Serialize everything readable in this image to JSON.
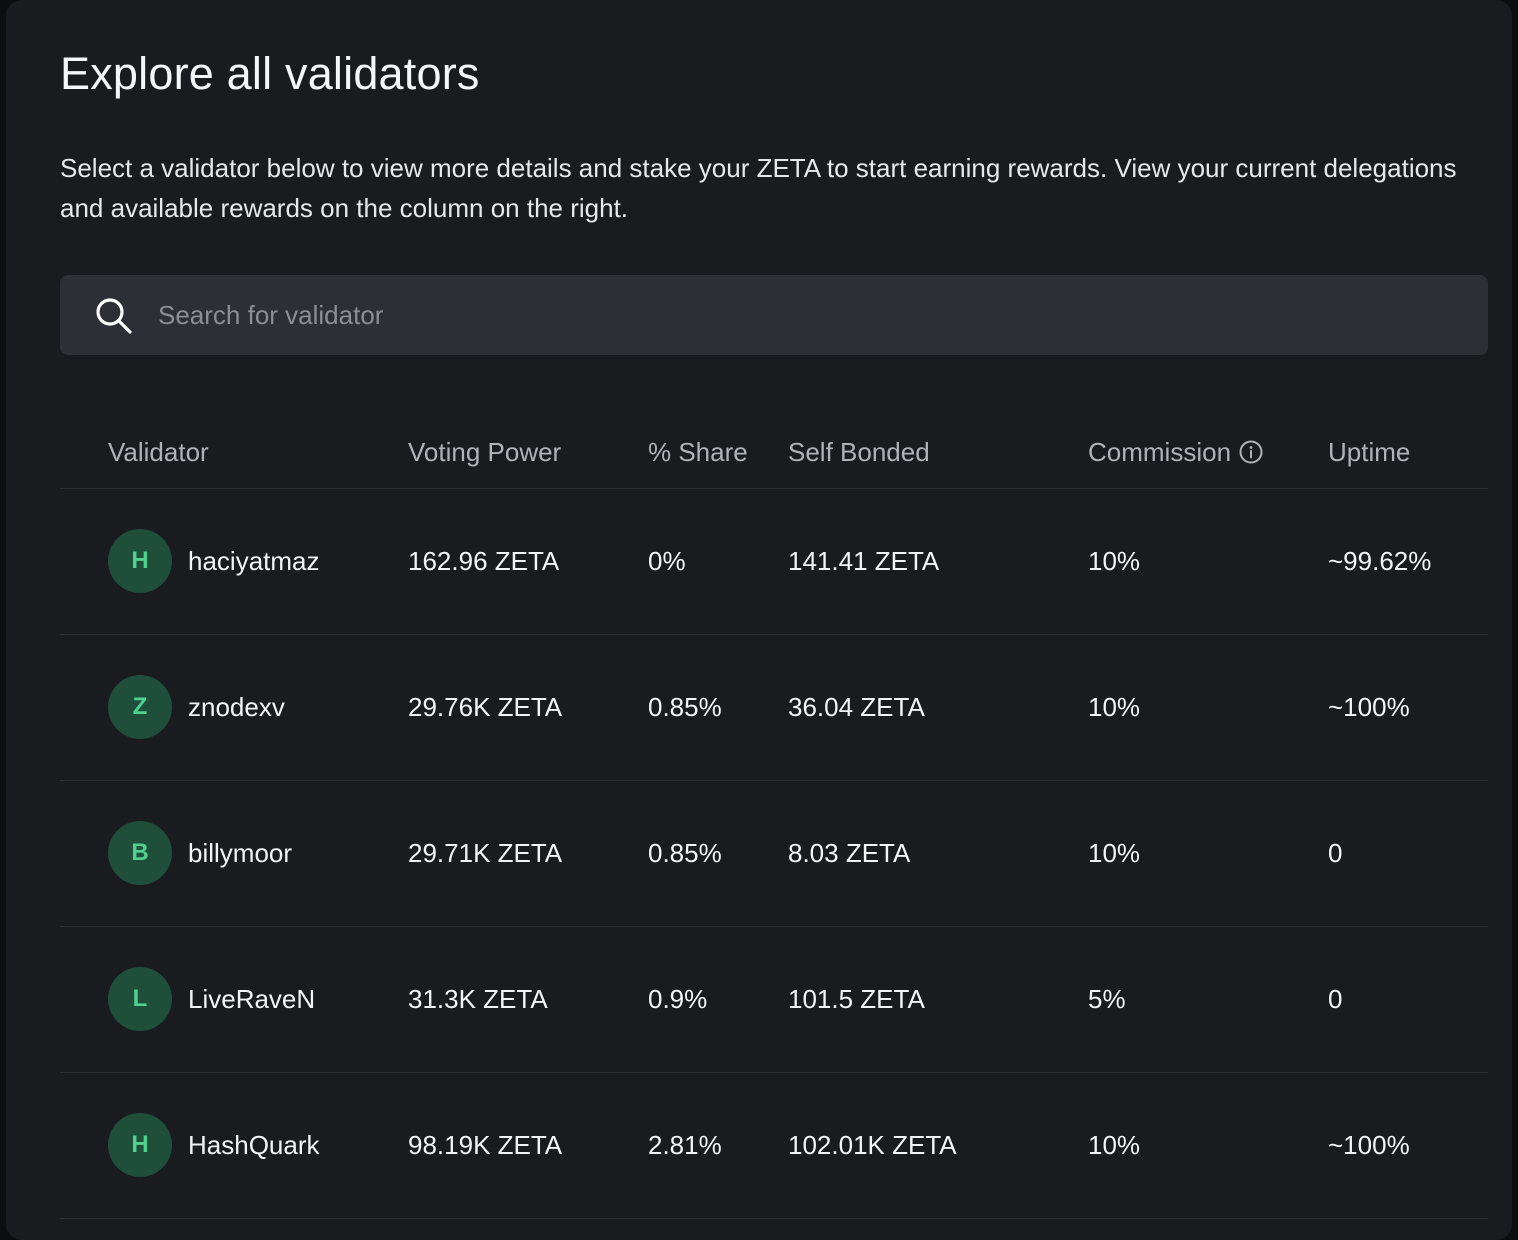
{
  "page": {
    "title": "Explore all validators",
    "description": "Select a validator below to view more details and stake your ZETA to start earning rewards. View your current delegations and available rewards on the column on the right."
  },
  "search": {
    "placeholder": "Search for validator",
    "value": "",
    "icon": "search-icon"
  },
  "table": {
    "headers": {
      "validator": "Validator",
      "voting_power": "Voting Power",
      "share": "% Share",
      "self_bonded": "Self Bonded",
      "commission": "Commission",
      "commission_icon": "info-icon",
      "uptime": "Uptime"
    },
    "rows": [
      {
        "initial": "H",
        "name": "haciyatmaz",
        "voting_power": "162.96 ZETA",
        "share": "0%",
        "self_bonded": "141.41 ZETA",
        "commission": "10%",
        "uptime": "~99.62%"
      },
      {
        "initial": "Z",
        "name": "znodexv",
        "voting_power": "29.76K ZETA",
        "share": "0.85%",
        "self_bonded": "36.04 ZETA",
        "commission": "10%",
        "uptime": "~100%"
      },
      {
        "initial": "B",
        "name": "billymoor",
        "voting_power": "29.71K ZETA",
        "share": "0.85%",
        "self_bonded": "8.03 ZETA",
        "commission": "10%",
        "uptime": "0"
      },
      {
        "initial": "L",
        "name": "LiveRaveN",
        "voting_power": "31.3K ZETA",
        "share": "0.9%",
        "self_bonded": "101.5 ZETA",
        "commission": "5%",
        "uptime": "0"
      },
      {
        "initial": "H",
        "name": "HashQuark",
        "voting_power": "98.19K ZETA",
        "share": "2.81%",
        "self_bonded": "102.01K ZETA",
        "commission": "10%",
        "uptime": "~100%"
      }
    ]
  },
  "colors": {
    "background": "#191b1f",
    "search_bg": "#2c2f35",
    "avatar_bg": "#1f4e3a",
    "avatar_text": "#4fd28e",
    "header_text": "#aeb3b9",
    "divider": "#2b2e33"
  }
}
